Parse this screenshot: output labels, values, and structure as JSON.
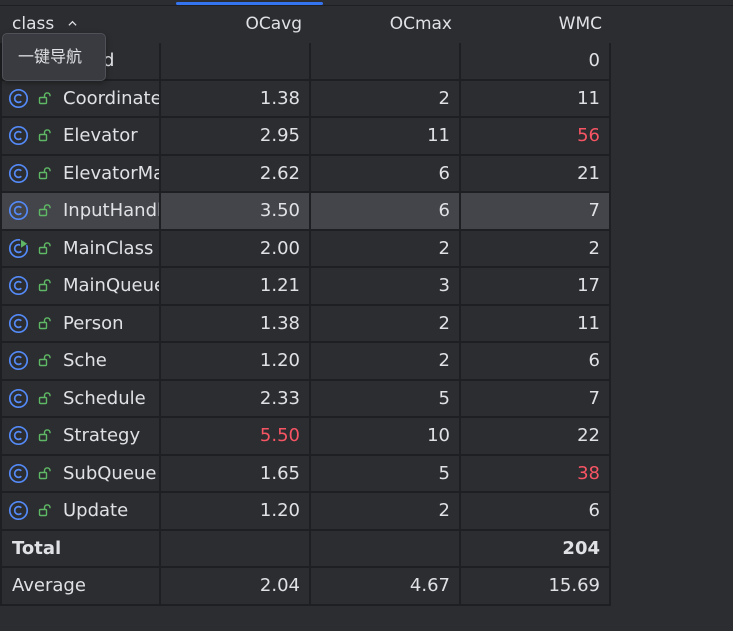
{
  "header": {
    "class_label": "class",
    "ocavg_label": "OCavg",
    "ocmax_label": "OCmax",
    "wmc_label": "WMC"
  },
  "tooltip": {
    "text": "一键导航"
  },
  "rows": [
    {
      "name": "Command",
      "visible_name": "mand",
      "ocavg": "",
      "ocmax": "",
      "wmc": "0",
      "icon": "class-icon",
      "visibility": "package-private-icon"
    },
    {
      "name": "Coordinate",
      "ocavg": "1.38",
      "ocmax": "2",
      "wmc": "11",
      "icon": "class-icon",
      "visibility": "package-private-icon"
    },
    {
      "name": "Elevator",
      "ocavg": "2.95",
      "ocmax": "11",
      "wmc": "56",
      "wmc_color": "#f75464",
      "icon": "class-icon",
      "visibility": "package-private-icon"
    },
    {
      "name": "ElevatorMa",
      "ocavg": "2.62",
      "ocmax": "6",
      "wmc": "21",
      "icon": "class-icon",
      "visibility": "package-private-icon"
    },
    {
      "name": "InputHandl",
      "ocavg": "3.50",
      "ocmax": "6",
      "wmc": "7",
      "icon": "class-icon",
      "visibility": "package-private-icon",
      "selected": true
    },
    {
      "name": "MainClass",
      "ocavg": "2.00",
      "ocmax": "2",
      "wmc": "2",
      "icon": "runnable-class-icon",
      "visibility": "package-private-icon"
    },
    {
      "name": "MainQueue",
      "ocavg": "1.21",
      "ocmax": "3",
      "wmc": "17",
      "icon": "class-icon",
      "visibility": "package-private-icon"
    },
    {
      "name": "Person",
      "ocavg": "1.38",
      "ocmax": "2",
      "wmc": "11",
      "icon": "class-icon",
      "visibility": "package-private-icon"
    },
    {
      "name": "Sche",
      "ocavg": "1.20",
      "ocmax": "2",
      "wmc": "6",
      "icon": "class-icon",
      "visibility": "package-private-icon"
    },
    {
      "name": "Schedule",
      "ocavg": "2.33",
      "ocmax": "5",
      "wmc": "7",
      "icon": "class-icon",
      "visibility": "package-private-icon"
    },
    {
      "name": "Strategy",
      "ocavg": "5.50",
      "ocavg_color": "#f75464",
      "ocmax": "10",
      "wmc": "22",
      "icon": "class-icon",
      "visibility": "package-private-icon"
    },
    {
      "name": "SubQueue",
      "ocavg": "1.65",
      "ocmax": "5",
      "wmc": "38",
      "wmc_color": "#f75464",
      "icon": "class-icon",
      "visibility": "package-private-icon"
    },
    {
      "name": "Update",
      "ocavg": "1.20",
      "ocmax": "2",
      "wmc": "6",
      "icon": "class-icon",
      "visibility": "package-private-icon"
    }
  ],
  "total": {
    "label": "Total",
    "ocavg": "",
    "ocmax": "",
    "wmc": "204"
  },
  "average": {
    "label": "Average",
    "ocavg": "2.04",
    "ocmax": "4.67",
    "wmc": "15.69"
  },
  "colors": {
    "background": "#2b2d30",
    "grid_line": "#1e1f22",
    "selection": "#43454a",
    "warning": "#f75464",
    "class_icon": "#548af7",
    "runnable_accent": "#5fb865",
    "lock_icon": "#5fb865",
    "active_tab": "#3574f0"
  }
}
